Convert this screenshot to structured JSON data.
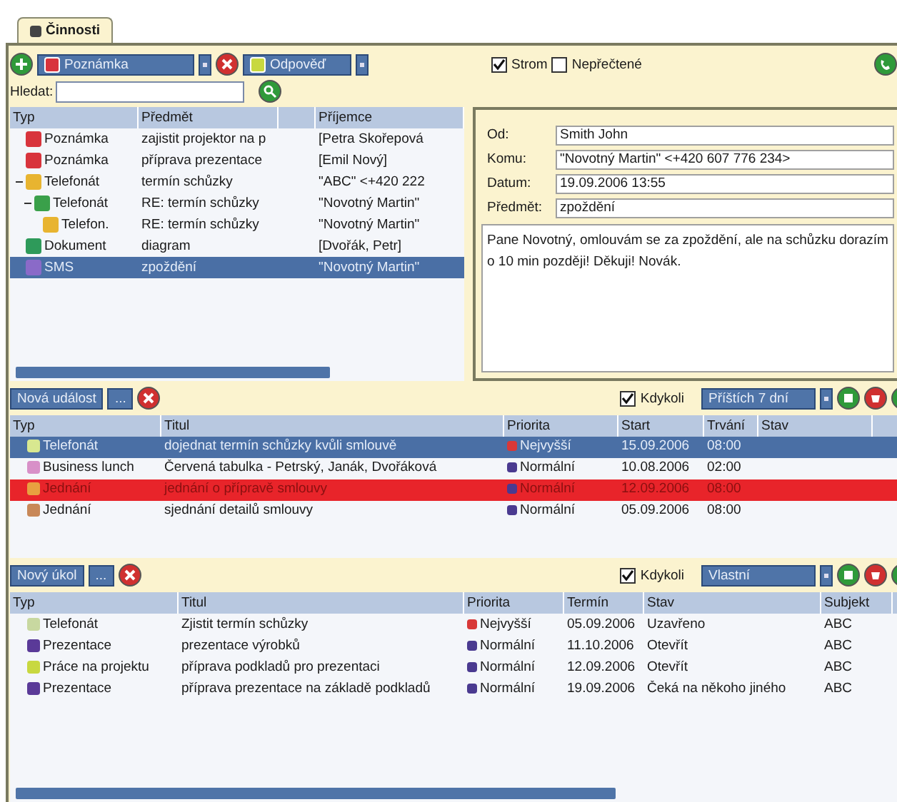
{
  "tabs": [
    {
      "label": "Činnosti",
      "selected": true
    }
  ],
  "toolbar": {
    "new_type": "Poznámka",
    "reply": "Odpověď",
    "search_label": "Hledat:",
    "options": [
      {
        "label": "Strom",
        "checked": true
      },
      {
        "label": "Nepřečtené",
        "checked": false
      }
    ]
  },
  "messages": {
    "columns": [
      "Typ",
      "Předmět",
      "Příjemce"
    ],
    "rows": [
      {
        "type": "Poznámka",
        "color": "#d8343c",
        "subject": "zajistit projektor na p",
        "recipient": "[Petra Skořepová",
        "selected": false
      },
      {
        "type": "Poznámka",
        "color": "#d8343c",
        "subject": "příprava prezentace",
        "recipient": "[Emil Nový]",
        "selected": false
      },
      {
        "type": "Telefonát",
        "color": "#e8b430",
        "subject": "termín schůzky",
        "recipient": "\"ABC\" <+420 222",
        "selected": false,
        "expanded": true,
        "children": [
          {
            "type": "Telefonát",
            "color": "#3aa04a",
            "subject": "RE: termín schůzky",
            "recipient": "\"Novotný Martin\"",
            "selected": false,
            "expanded": true,
            "children": [
              {
                "type": "Telefon.",
                "color": "#e8b430",
                "subject": "RE: termín schůzky",
                "recipient": "\"Novotný Martin\"",
                "selected": false
              }
            ]
          }
        ]
      },
      {
        "type": "Dokument",
        "color": "#2e9a5a",
        "subject": "diagram",
        "recipient": "[Dvořák, Petr]",
        "selected": false
      },
      {
        "type": "SMS",
        "color": "#8a6ac8",
        "subject": "zpoždění",
        "recipient": "\"Novotný Martin\"",
        "selected": true
      }
    ]
  },
  "detail": {
    "fields": [
      {
        "label": "Od:",
        "value": "Smith John"
      },
      {
        "label": "Komu:",
        "value": "\"Novotný Martin\" <+420 607 776 234>"
      },
      {
        "label": "Datum:",
        "value": "19.09.2006 13:55"
      },
      {
        "label": "Předmět:",
        "value": "zpoždění"
      }
    ],
    "body": "Pane Novotný, omlouvám se za zpoždění, ale na schůzku dorazím o 10 min později! Děkuji! Novák."
  },
  "events": {
    "new_button": "Nová událost",
    "more_button": "...",
    "anytime": {
      "label": "Kdykoli",
      "checked": true
    },
    "range": "Příštích 7 dní",
    "columns": [
      "Typ",
      "Titul",
      "Priorita",
      "Start",
      "Trvání",
      "Stav"
    ],
    "rows": [
      {
        "type": "Telefonát",
        "color": "#d8e890",
        "title": "dojednat termín schůzky kvůli smlouvě",
        "priority": {
          "label": "Nejvyšší",
          "color": "#d83838"
        },
        "start": "15.09.2006",
        "duration": "08:00",
        "selected": true,
        "flagged": false
      },
      {
        "type": "Business lunch",
        "color": "#d890c8",
        "title": "Červená tabulka - Petrský, Janák, Dvořáková",
        "priority": {
          "label": "Normální",
          "color": "#4a3a90"
        },
        "start": "10.08.2006",
        "duration": "02:00",
        "selected": false,
        "flagged": false
      },
      {
        "type": "Jednání",
        "color": "#e8a040",
        "title": "jednání o přípravě smlouvy",
        "priority": {
          "label": "Normální",
          "color": "#4a3a90"
        },
        "start": "12.09.2006",
        "duration": "08:00",
        "selected": false,
        "flagged": true
      },
      {
        "type": "Jednání",
        "color": "#c88858",
        "title": "sjednání detailů smlouvy",
        "priority": {
          "label": "Normální",
          "color": "#4a3a90"
        },
        "start": "05.09.2006",
        "duration": "08:00",
        "selected": false,
        "flagged": false
      }
    ]
  },
  "tasks": {
    "new_button": "Nový úkol",
    "more_button": "...",
    "anytime": {
      "label": "Kdykoli",
      "checked": true
    },
    "range": "Vlastní",
    "columns": [
      "Typ",
      "Titul",
      "Priorita",
      "Termín",
      "Stav",
      "Subjekt"
    ],
    "rows": [
      {
        "type": "Telefonát",
        "color": "#c8d8a0",
        "title": "Zjistit termín schůzky",
        "priority": {
          "label": "Nejvyšší",
          "color": "#d83838"
        },
        "due": "05.09.2006",
        "status": "Uzavřeno",
        "subject": "ABC"
      },
      {
        "type": "Prezentace",
        "color": "#5a3a98",
        "title": "prezentace výrobků",
        "priority": {
          "label": "Normální",
          "color": "#4a3a90"
        },
        "due": "11.10.2006",
        "status": "Otevřít",
        "subject": "ABC"
      },
      {
        "type": "Práce na projektu",
        "color": "#c8d840",
        "title": "příprava podkladů pro prezentaci",
        "priority": {
          "label": "Normální",
          "color": "#4a3a90"
        },
        "due": "12.09.2006",
        "status": "Otevřít",
        "subject": "ABC"
      },
      {
        "type": "Prezentace",
        "color": "#5a3a98",
        "title": "příprava prezentace na základě podkladů",
        "priority": {
          "label": "Normální",
          "color": "#4a3a90"
        },
        "due": "19.09.2006",
        "status": "Čeká na někoho jiného",
        "subject": "ABC"
      }
    ]
  }
}
